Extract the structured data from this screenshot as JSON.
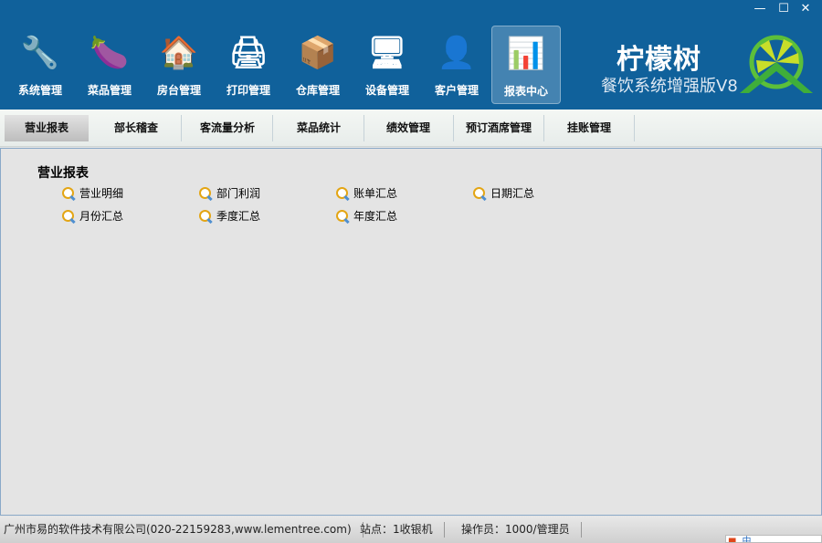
{
  "window": {
    "minimize": "—",
    "maximize": "☐",
    "close": "✕"
  },
  "nav": [
    {
      "label": "系统管理",
      "icon": "🔧"
    },
    {
      "label": "菜品管理",
      "icon": "🍆"
    },
    {
      "label": "房台管理",
      "icon": "🏠"
    },
    {
      "label": "打印管理",
      "icon": "🖨"
    },
    {
      "label": "仓库管理",
      "icon": "📦"
    },
    {
      "label": "设备管理",
      "icon": "🖥"
    },
    {
      "label": "客户管理",
      "icon": "👤"
    },
    {
      "label": "报表中心",
      "icon": "📊"
    }
  ],
  "brand": {
    "title": "柠檬树",
    "subtitle": "餐饮系统增强版V8"
  },
  "subtabs": [
    "营业报表",
    "部长稽查",
    "客流量分析",
    "菜品统计",
    "绩效管理",
    "预订酒席管理",
    "挂账管理"
  ],
  "content": {
    "title": "营业报表",
    "items": [
      "营业明细",
      "部门利润",
      "账单汇总",
      "日期汇总",
      "月份汇总",
      "季度汇总",
      "年度汇总"
    ]
  },
  "status": {
    "company": "广州市易的软件技术有限公司(020-22159283,www.lementree.com)",
    "station": "站点：1收银机",
    "operator": "操作员：1000/管理员"
  },
  "ime": {
    "label": "中"
  }
}
